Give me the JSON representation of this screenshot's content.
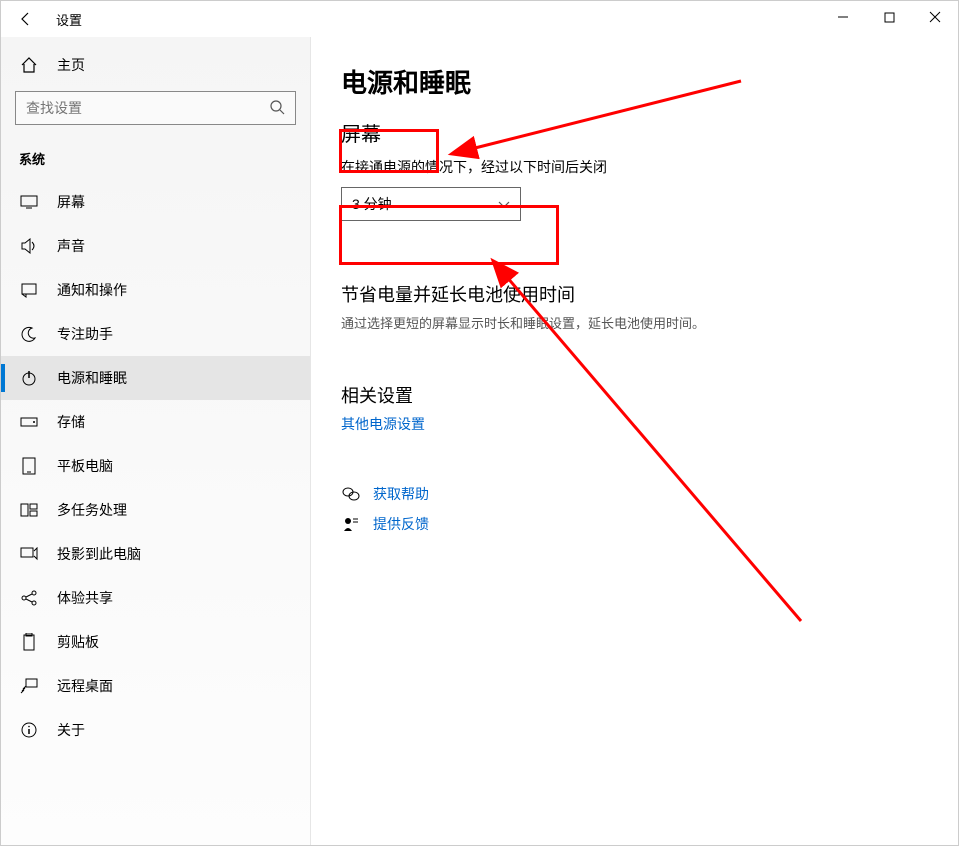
{
  "window": {
    "title": "设置"
  },
  "sidebar": {
    "home": "主页",
    "search_placeholder": "查找设置",
    "section": "系统",
    "items": [
      {
        "label": "屏幕"
      },
      {
        "label": "声音"
      },
      {
        "label": "通知和操作"
      },
      {
        "label": "专注助手"
      },
      {
        "label": "电源和睡眠"
      },
      {
        "label": "存储"
      },
      {
        "label": "平板电脑"
      },
      {
        "label": "多任务处理"
      },
      {
        "label": "投影到此电脑"
      },
      {
        "label": "体验共享"
      },
      {
        "label": "剪贴板"
      },
      {
        "label": "远程桌面"
      },
      {
        "label": "关于"
      }
    ],
    "active_index": 4
  },
  "content": {
    "page_title": "电源和睡眠",
    "section_screen": "屏幕",
    "screen_desc": "在接通电源的情况下，经过以下时间后关闭",
    "dropdown_value": "3 分钟",
    "save_power_heading": "节省电量并延长电池使用时间",
    "save_power_desc": "通过选择更短的屏幕显示时长和睡眠设置，延长电池使用时间。",
    "related_heading": "相关设置",
    "related_link": "其他电源设置",
    "get_help": "获取帮助",
    "feedback": "提供反馈"
  }
}
